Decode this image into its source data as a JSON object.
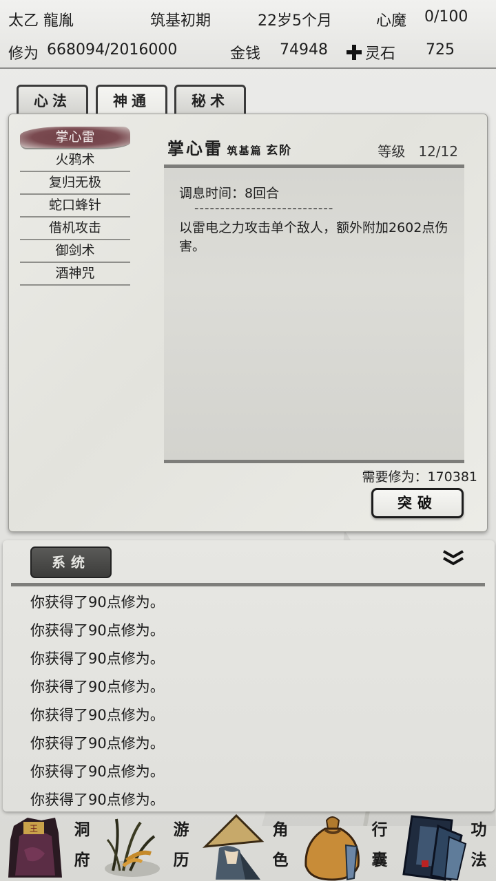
{
  "status": {
    "name": "太乙 龍胤",
    "realm": "筑基初期",
    "age": "22岁5个月",
    "demon_label": "心魔",
    "demon_value": "0/100",
    "cultivation_label": "修为",
    "cultivation_value": "668094/2016000",
    "money_label": "金钱",
    "money_value": "74948",
    "stone_label": "灵石",
    "stone_value": "725"
  },
  "tabs": [
    {
      "label": "心法"
    },
    {
      "label": "神通"
    },
    {
      "label": "秘术"
    }
  ],
  "skills": [
    {
      "label": "掌心雷"
    },
    {
      "label": "火鸦术"
    },
    {
      "label": "复归无极"
    },
    {
      "label": "蛇口蜂针"
    },
    {
      "label": "借机攻击"
    },
    {
      "label": "御剑术"
    },
    {
      "label": "酒神咒"
    }
  ],
  "detail": {
    "name": "掌心雷",
    "grade": "筑基篇",
    "tier": "玄阶",
    "level_label": "等级",
    "level_value": "12/12",
    "cooldown": "调息时间：8回合",
    "separator": "---------------------------",
    "description": "以雷电之力攻击单个敌人，额外附加2602点伤害。",
    "requirement": "需要修为：170381",
    "breakthrough_label": "突破"
  },
  "log": {
    "system_label": "系统",
    "messages": [
      "你获得了90点修为。",
      "你获得了90点修为。",
      "你获得了90点修为。",
      "你获得了90点修为。",
      "你获得了90点修为。",
      "你获得了90点修为。",
      "你获得了90点修为。",
      "你获得了90点修为。"
    ]
  },
  "nav": [
    {
      "top": "洞",
      "bottom": "府",
      "icon": "cave-dwelling-icon"
    },
    {
      "top": "游",
      "bottom": "历",
      "icon": "travel-herb-icon"
    },
    {
      "top": "角",
      "bottom": "色",
      "icon": "character-hat-icon"
    },
    {
      "top": "行",
      "bottom": "囊",
      "icon": "bag-icon"
    },
    {
      "top": "功",
      "bottom": "法",
      "icon": "books-icon"
    }
  ],
  "colors": {
    "selected_skill": "#74454b",
    "frame_dark": "#3a3a3a",
    "paper": "#e7e7e2"
  }
}
